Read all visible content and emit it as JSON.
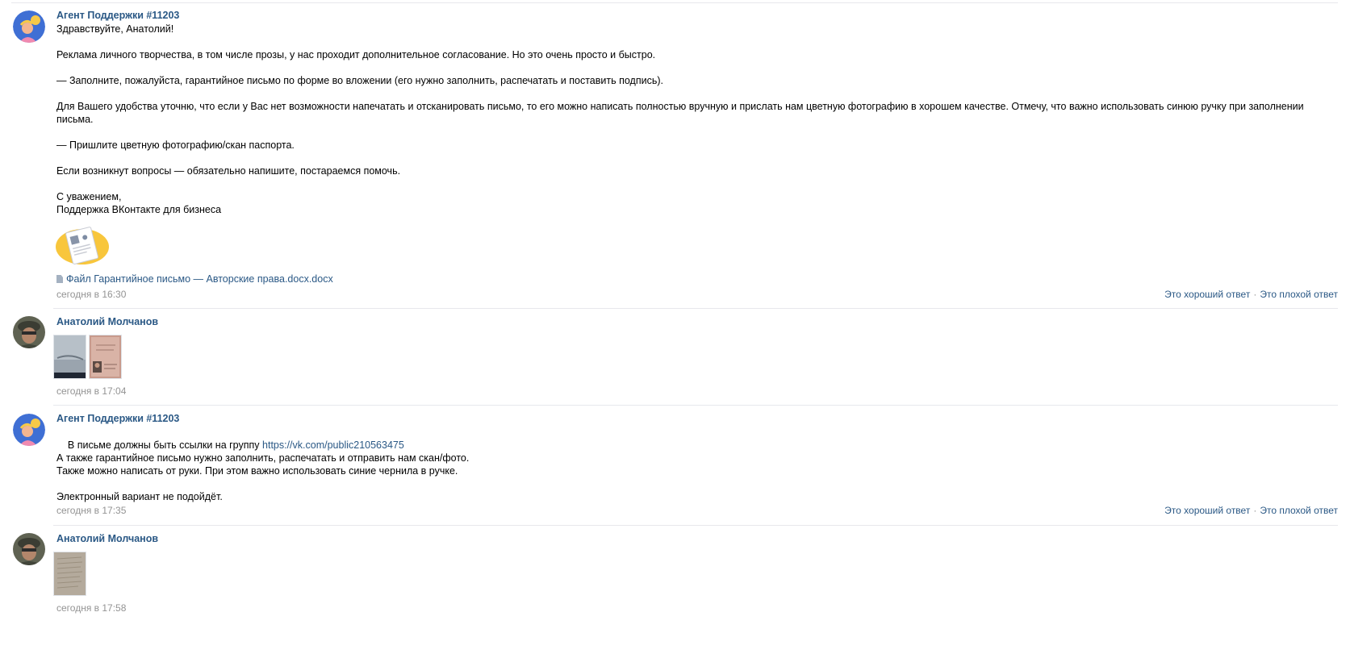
{
  "messages": [
    {
      "author": "Агент Поддержки #11203",
      "avatar_icon": "support-agent-avatar-icon",
      "paragraphs": [
        "Здравствуйте, Анатолий!",
        "Реклама личного творчества, в том числе прозы, у нас проходит дополнительное согласование. Но это очень просто и быстро.",
        "— Заполните, пожалуйста, гарантийное письмо по форме во вложении (его нужно заполнить, распечатать и поставить подпись).",
        "Для Вашего удобства уточню, что если у Вас нет возможности напечатать и отсканировать письмо, то его можно написать полностью вручную и прислать нам цветную фотографию в хорошем качестве. Отмечу, что важно использовать синюю ручку при заполнении письма.",
        "— Пришлите цветную фотографию/скан паспорта.",
        "Если возникнут вопросы — обязательно напишите, постараемся помочь.",
        "С уважением,\nПоддержка ВКонтакте для бизнеса"
      ],
      "attachment_file": "Файл Гарантийное письмо — Авторские права.docx.docx",
      "time": "сегодня в 16:30",
      "rate_good": "Это хороший ответ",
      "rate_sep": "·",
      "rate_bad": "Это плохой ответ"
    },
    {
      "author": "Анатолий Молчанов",
      "avatar_icon": "user-photo-avatar-icon",
      "time": "сегодня в 17:04"
    },
    {
      "author": "Агент Поддержки #11203",
      "avatar_icon": "support-agent-avatar-icon",
      "line1_text": "В письме должны быть ссылки на группу ",
      "line1_link": "https://vk.com/public210563475",
      "paragraphs": [
        "А также гарантийное письмо нужно заполнить, распечатать и отправить нам скан/фото.\nТакже можно написать от руки. При этом важно использовать синие чернила в ручке.",
        "Электронный вариант не подойдёт."
      ],
      "time": "сегодня в 17:35",
      "rate_good": "Это хороший ответ",
      "rate_sep": "·",
      "rate_bad": "Это плохой ответ"
    },
    {
      "author": "Анатолий Молчанов",
      "avatar_icon": "user-photo-avatar-icon",
      "time": "сегодня в 17:58"
    }
  ],
  "colors": {
    "link": "#2a5885",
    "meta": "#939393",
    "separator": "#e7e8ec"
  }
}
